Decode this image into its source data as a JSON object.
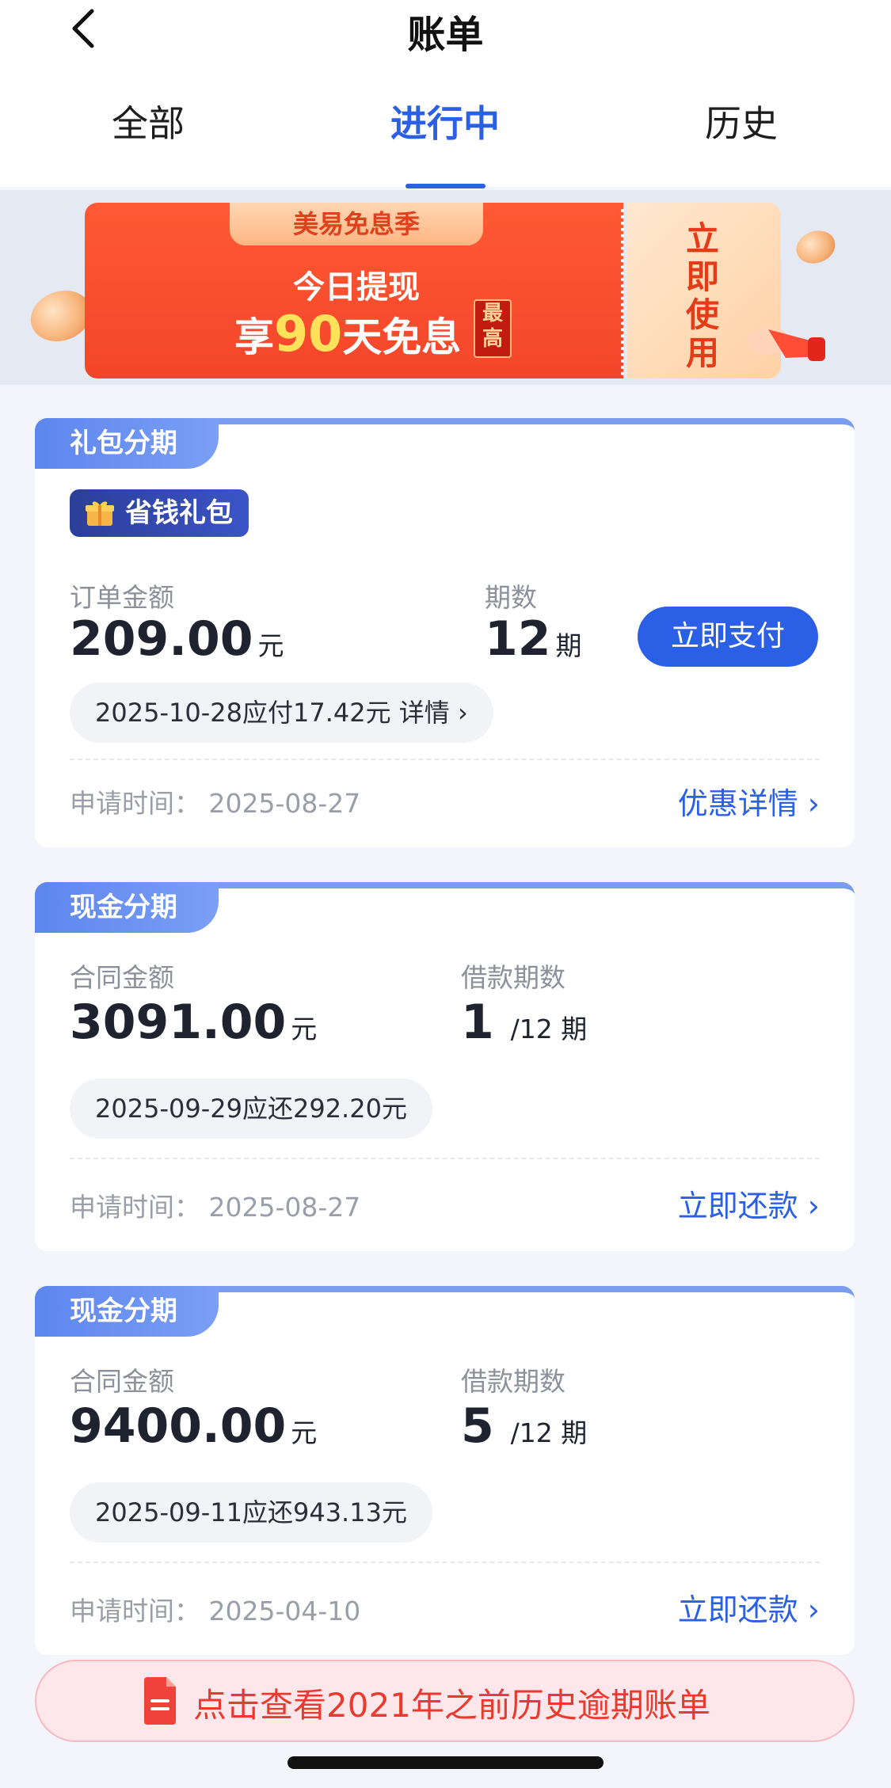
{
  "header": {
    "title": "账单",
    "back_icon": "chevron-left-icon"
  },
  "tabs": [
    {
      "label": "全部",
      "active": false
    },
    {
      "label": "进行中",
      "active": true
    },
    {
      "label": "历史",
      "active": false
    }
  ],
  "banner": {
    "tag": "美易免息季",
    "line1": "今日提现",
    "line2_prefix": "享",
    "line2_number": "90",
    "line2_suffix": "天免息",
    "highest": "最高",
    "cta": "立即使用"
  },
  "cards": [
    {
      "type": "礼包分期",
      "badge": "省钱礼包",
      "amount_label": "订单金额",
      "amount": "209.00",
      "amount_unit": "元",
      "period_label": "期数",
      "period_value": "12",
      "period_unit": "期",
      "pay_button": "立即支付",
      "due_text": "2025-10-28应付17.42元 详情",
      "apply_text": "申请时间：  2025-08-27",
      "link_text": "优惠详情"
    },
    {
      "type": "现金分期",
      "amount_label": "合同金额",
      "amount": "3091.00",
      "amount_unit": "元",
      "period_label": "借款期数",
      "period_current": "1",
      "period_total": "/12 期",
      "due_text": "2025-09-29应还292.20元",
      "apply_text": "申请时间：  2025-08-27",
      "link_text": "立即还款"
    },
    {
      "type": "现金分期",
      "amount_label": "合同金额",
      "amount": "9400.00",
      "amount_unit": "元",
      "period_label": "借款期数",
      "period_current": "5",
      "period_total": "/12 期",
      "due_text": "2025-09-11应还943.13元",
      "apply_text": "申请时间：  2025-04-10",
      "link_text": "立即还款"
    }
  ],
  "bottom_bar": {
    "text": "点击查看2021年之前历史逾期账单",
    "icon": "document-icon"
  },
  "colors": {
    "accent": "#2b5fe6",
    "card_tag": "#6a8ff2",
    "banner_red": "#f3452a",
    "bottom_text": "#e83a2e"
  }
}
